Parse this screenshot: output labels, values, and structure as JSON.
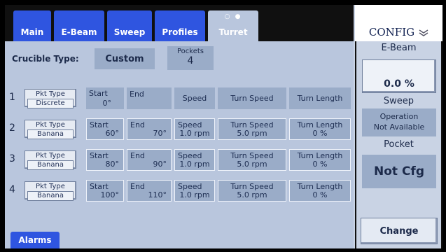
{
  "tabs": [
    {
      "label": "Main"
    },
    {
      "label": "E-Beam"
    },
    {
      "label": "Sweep"
    },
    {
      "label": "Profiles"
    },
    {
      "label": "Turret",
      "dots": "○ ●"
    }
  ],
  "crucible": {
    "label": "Crucible Type:",
    "value": "Custom"
  },
  "pockets": {
    "label": "Pockets",
    "value": "4"
  },
  "header_row": {
    "num": "1",
    "pkt_label": "Pkt Type",
    "pkt_value": "Discrete",
    "start_label": "Start",
    "start_value": "0°",
    "end": "End",
    "speed": "Speed",
    "turn_speed": "Turn Speed",
    "turn_length": "Turn Length"
  },
  "rows": [
    {
      "num": "2",
      "pkt_label": "Pkt Type",
      "pkt_value": "Banana",
      "start_label": "Start",
      "start": "60°",
      "end_label": "End",
      "end": "70°",
      "speed_label": "Speed",
      "speed": "1.0 rpm",
      "turn_speed_label": "Turn Speed",
      "turn_speed": "5.0 rpm",
      "turn_length_label": "Turn Length",
      "turn_length": "0 %"
    },
    {
      "num": "3",
      "pkt_label": "Pkt Type",
      "pkt_value": "Banana",
      "start_label": "Start",
      "start": "80°",
      "end_label": "End",
      "end": "90°",
      "speed_label": "Speed",
      "speed": "1.0 rpm",
      "turn_speed_label": "Turn Speed",
      "turn_speed": "5.0 rpm",
      "turn_length_label": "Turn Length",
      "turn_length": "0 %"
    },
    {
      "num": "4",
      "pkt_label": "Pkt Type",
      "pkt_value": "Banana",
      "start_label": "Start",
      "start": "100°",
      "end_label": "End",
      "end": "110°",
      "speed_label": "Speed",
      "speed": "1.0 rpm",
      "turn_speed_label": "Turn Speed",
      "turn_speed": "5.0 rpm",
      "turn_length_label": "Turn Length",
      "turn_length": "0 %"
    }
  ],
  "alarms": "Alarms",
  "side": {
    "config": "CONFIG",
    "config_icon": "chevron-down-icon",
    "ebeam_label": "E-Beam",
    "ebeam_value": "0.0 %",
    "sweep_label": "Sweep",
    "sweep_line1": "Operation",
    "sweep_line2": "Not Available",
    "pocket_label": "Pocket",
    "pocket_value": "Not Cfg",
    "change": "Change"
  },
  "colors": {
    "tab_blue": "#2f55e0",
    "panel": "#b9c6dd",
    "cell": "#9aacc8"
  }
}
